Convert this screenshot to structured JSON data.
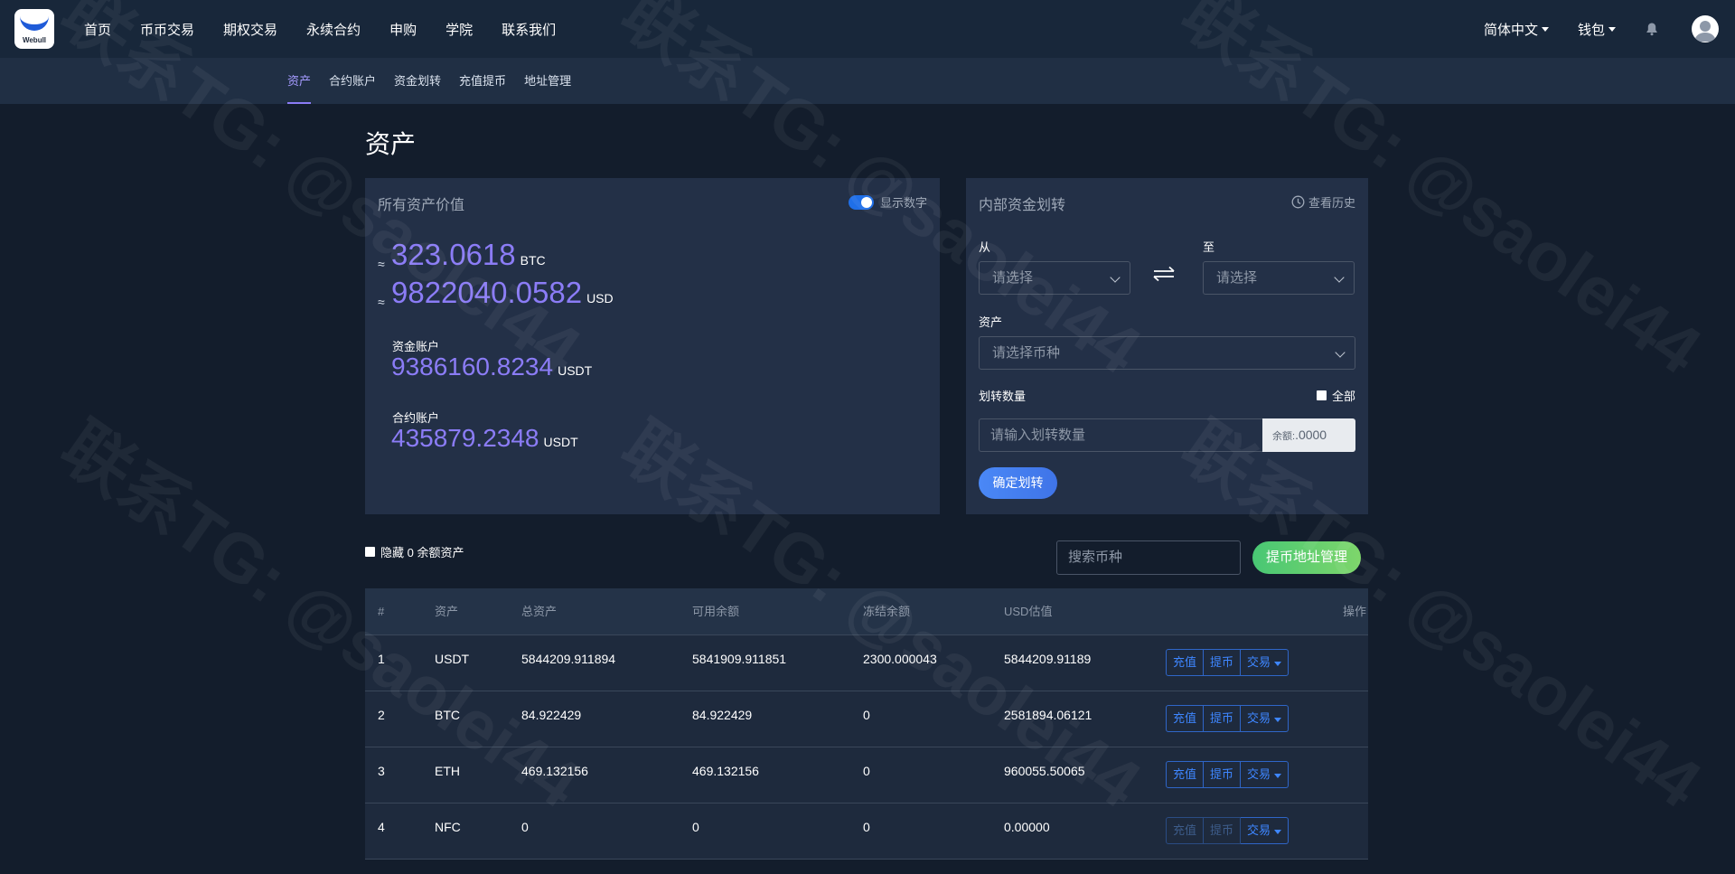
{
  "topnav": {
    "logo_text": "Webull",
    "items": [
      "首页",
      "币币交易",
      "期权交易",
      "永续合约",
      "申购",
      "学院",
      "联系我们"
    ],
    "language": "简体中文",
    "wallet": "钱包"
  },
  "subnav": {
    "items": [
      "资产",
      "合约账户",
      "资金划转",
      "充值提币",
      "地址管理"
    ],
    "active": "资产"
  },
  "page_title": "资产",
  "summary": {
    "title": "所有资产价值",
    "toggle_label": "显示数字",
    "approx": "≈",
    "btc_value": "323.0618",
    "btc_unit": "BTC",
    "usd_value": "9822040.0582",
    "usd_unit": "USD",
    "fund_account_label": "资金账户",
    "fund_account_value": "9386160.8234",
    "fund_account_unit": "USDT",
    "contract_account_label": "合约账户",
    "contract_account_value": "435879.2348",
    "contract_account_unit": "USDT"
  },
  "transfer": {
    "title": "内部资金划转",
    "history": "查看历史",
    "from_label": "从",
    "to_label": "至",
    "from_placeholder": "请选择",
    "to_placeholder": "请选择",
    "asset_label": "资产",
    "asset_placeholder": "请选择币种",
    "amount_label": "划转数量",
    "all_label": "全部",
    "amount_placeholder": "请输入划转数量",
    "balance_prefix": "余额:",
    "balance_value": ".0000",
    "confirm": "确定划转"
  },
  "table_controls": {
    "hide_zero": "隐藏 0 余额资产",
    "search_placeholder": "搜索币种",
    "address_button": "提币地址管理"
  },
  "table": {
    "headers": [
      "#",
      "资产",
      "总资产",
      "可用余额",
      "冻结余额",
      "USD估值",
      "操作"
    ],
    "rows": [
      {
        "idx": "1",
        "asset": "USDT",
        "total": "5844209.911894",
        "available": "5841909.911851",
        "frozen": "2300.000043",
        "usd": "5844209.91189"
      },
      {
        "idx": "2",
        "asset": "BTC",
        "total": "84.922429",
        "available": "84.922429",
        "frozen": "0",
        "usd": "2581894.06121"
      },
      {
        "idx": "3",
        "asset": "ETH",
        "total": "469.132156",
        "available": "469.132156",
        "frozen": "0",
        "usd": "960055.50065"
      },
      {
        "idx": "4",
        "asset": "NFC",
        "total": "0",
        "available": "0",
        "frozen": "0",
        "usd": "0.00000"
      }
    ],
    "actions": {
      "deposit": "充值",
      "withdraw": "提币",
      "trade": "交易"
    }
  },
  "watermark": "联系TG: @saolei44",
  "colors": {
    "accent_purple": "#8b7cf6",
    "primary_blue": "#3e86ff",
    "success_green": "#48c774",
    "background": "#131d2c"
  }
}
